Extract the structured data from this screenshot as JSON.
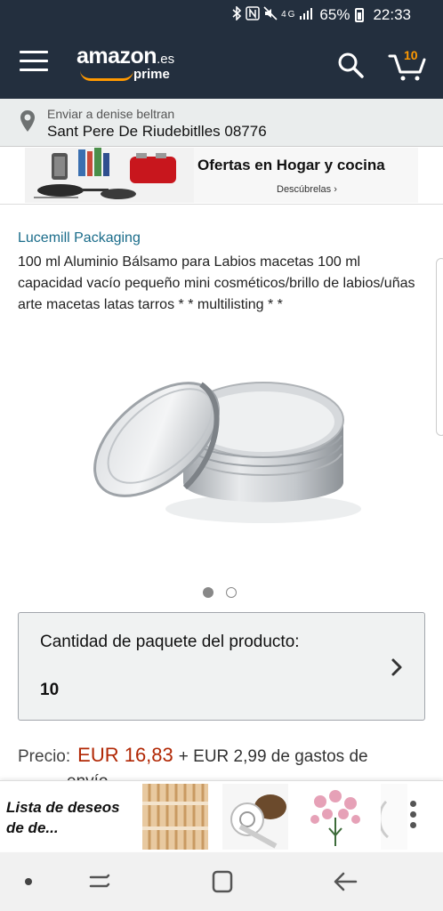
{
  "status_bar": {
    "signal_label": "4G",
    "battery_percent": "65%",
    "time": "22:33",
    "icons": [
      "bluetooth-icon",
      "nfc-icon",
      "mute-icon",
      "signal-icon",
      "battery-icon"
    ]
  },
  "header": {
    "logo_word": "amazon",
    "logo_tld": ".es",
    "logo_prime": "prime",
    "cart_count": "10",
    "icons": [
      "menu-icon",
      "search-icon",
      "cart-icon"
    ]
  },
  "delivery": {
    "line1": "Enviar a denise beltran",
    "line2": "Sant Pere De Riudebitlles 08776",
    "icon": "location-pin-icon"
  },
  "banner": {
    "title": "Ofertas en Hogar y cocina",
    "subtitle": "Descúbrelas ›"
  },
  "product": {
    "brand": "Lucemill Packaging",
    "title": "100 ml Aluminio Bálsamo para Labios macetas 100 ml capacidad vacío pequeño mini cosméticos/brillo de labios/uñas arte macetas latas tarros * * multilisting * *",
    "image_count": 2,
    "active_image": 1
  },
  "quantity": {
    "label": "Cantidad de paquete del producto:",
    "value": "10",
    "icon": "chevron-right-icon"
  },
  "price": {
    "label": "Precio:",
    "value": "EUR 16,83",
    "shipping": "+ EUR 2,99 de gastos de",
    "shipping_cont": "envío"
  },
  "wishlist": {
    "title": "Lista de deseos de de...",
    "more_icon": "more-vertical-icon"
  },
  "navbar": {
    "icons": [
      "dot-icon",
      "recents-icon",
      "home-icon",
      "back-icon"
    ]
  },
  "colors": {
    "header_bg": "#232f3e",
    "accent_orange": "#ff9900",
    "link_teal": "#1a6c8a",
    "price_red": "#b12704"
  }
}
